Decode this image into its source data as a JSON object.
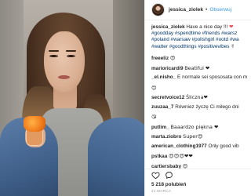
{
  "header": {
    "username": "jessica_ziolek",
    "separator": "•",
    "follow_label": "Obserwuj"
  },
  "caption": {
    "username": "jessica_ziolek",
    "text": "Have a nice day !!!",
    "heart": "❤",
    "tags_line1": "#goodday #spendtime #friends #warsz",
    "tags_line2": "#poland #warsaw #polishgirl #ootd #wa",
    "tags_line3": "#watter #goodthings #positivevibes",
    "tags_end": "✌"
  },
  "comments": [
    {
      "user": "freeeliz",
      "text": "😍"
    },
    {
      "user": "marioricardi9",
      "text": "Beatiful ❤"
    },
    {
      "user": "_el.nisho_",
      "text": "É normale sei spososata con m"
    },
    {
      "user": "",
      "text": "😊"
    },
    {
      "user": "secretvoice12",
      "text": "Śliczna❤"
    },
    {
      "user": "zuuzaa_7",
      "text": "Równiez życzę Ci miłego dni"
    },
    {
      "user": "",
      "text": "😘"
    },
    {
      "user": "putlim_",
      "text": "Baaardzo piękna ❤"
    },
    {
      "user": "marta.ziobro",
      "text": "Super😍"
    },
    {
      "user": "american_clothing1977",
      "text": "Only good vib"
    },
    {
      "user": "pstkaa",
      "text": "😍😍😍❤❤"
    },
    {
      "user": "cartiersbaby",
      "text": "😍"
    }
  ],
  "likes_text": "5 218 polubień",
  "date_text": "21 MARCA",
  "icons": {
    "like": "heart-outline-icon",
    "comment": "comment-bubble-icon"
  },
  "colors": {
    "link": "#3897f0",
    "hashtag": "#003569",
    "heart": "#ed4956",
    "text": "#262626",
    "muted": "#999999"
  }
}
